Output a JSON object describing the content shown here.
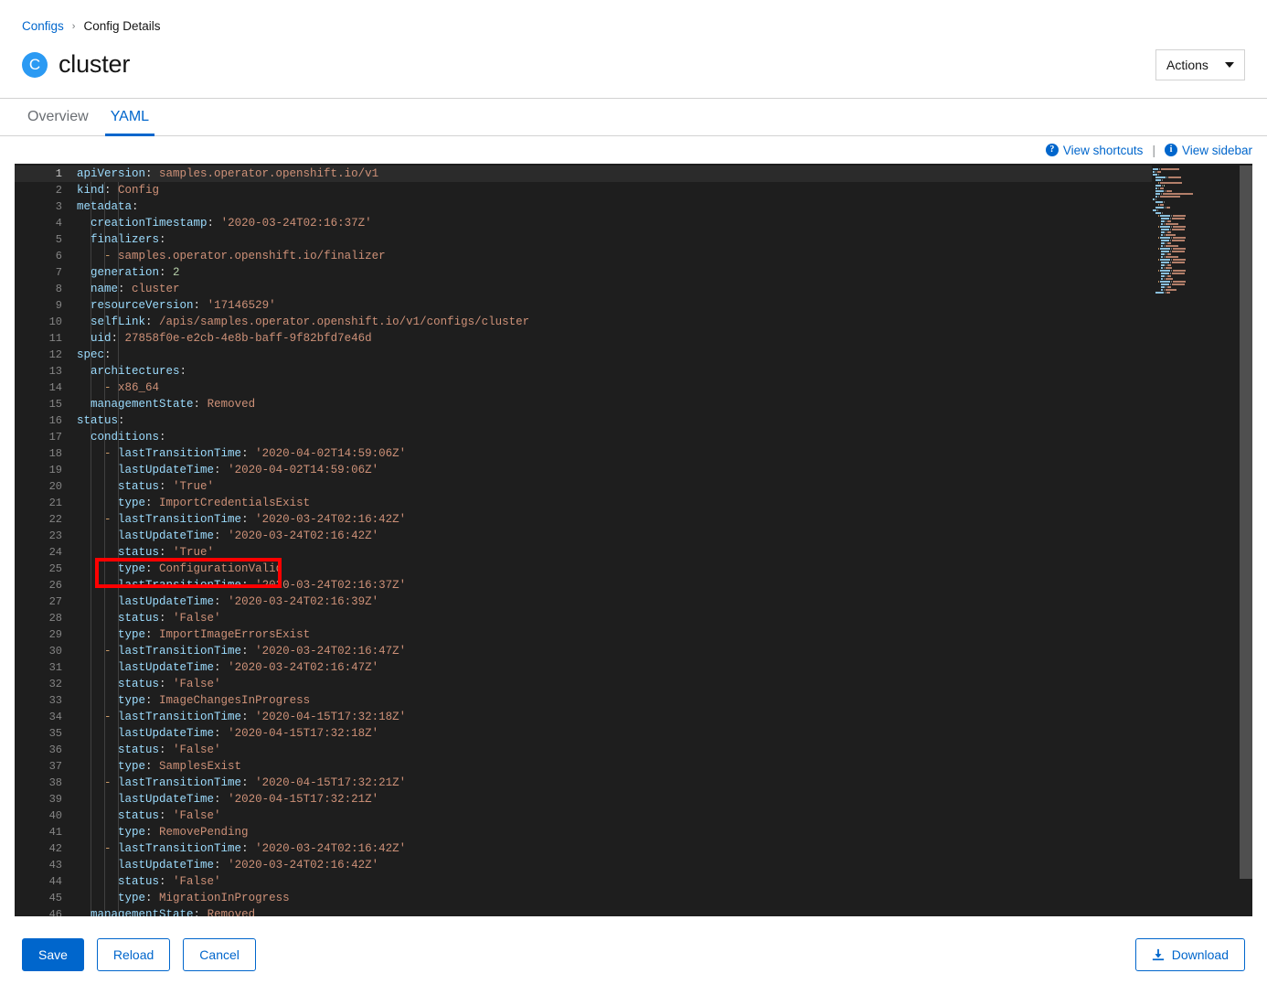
{
  "breadcrumb": {
    "parent": "Configs",
    "separator": "›",
    "current": "Config Details"
  },
  "header": {
    "badge_letter": "C",
    "resource_name": "cluster",
    "actions_label": "Actions",
    "badge_color": "#2b9af3"
  },
  "tabs": [
    {
      "label": "Overview",
      "active": false
    },
    {
      "label": "YAML",
      "active": true
    }
  ],
  "view_links": {
    "shortcuts_icon": "question-circle-icon",
    "shortcuts_label": "View shortcuts",
    "divider": "|",
    "sidebar_icon": "info-circle-icon",
    "sidebar_label": "View sidebar"
  },
  "annotation": {
    "type": "red-rectangle-highlight",
    "color": "#ff0000",
    "target_line": 15,
    "target_text": "managementState: Removed"
  },
  "editor": {
    "language": "yaml",
    "theme": "dark",
    "active_line": 1,
    "total_visible_lines": 46,
    "colors": {
      "background": "#1e1e1e",
      "active_line": "#2b2b2b",
      "line_number": "#858585",
      "line_number_active": "#c6c6c6",
      "key": "#9cdcfe",
      "value": "#ce9178",
      "number": "#b5cea8",
      "punctuation": "#d4d4d4"
    },
    "lines": [
      {
        "n": 1,
        "indent": 0,
        "tokens": [
          {
            "t": "key",
            "v": "apiVersion"
          },
          {
            "t": "punc",
            "v": ": "
          },
          {
            "t": "val",
            "v": "samples.operator.openshift.io/v1"
          }
        ]
      },
      {
        "n": 2,
        "indent": 0,
        "tokens": [
          {
            "t": "key",
            "v": "kind"
          },
          {
            "t": "punc",
            "v": ": "
          },
          {
            "t": "val",
            "v": "Config"
          }
        ]
      },
      {
        "n": 3,
        "indent": 0,
        "tokens": [
          {
            "t": "key",
            "v": "metadata"
          },
          {
            "t": "punc",
            "v": ":"
          }
        ]
      },
      {
        "n": 4,
        "indent": 1,
        "tokens": [
          {
            "t": "key",
            "v": "creationTimestamp"
          },
          {
            "t": "punc",
            "v": ": "
          },
          {
            "t": "val",
            "v": "'2020-03-24T02:16:37Z'"
          }
        ]
      },
      {
        "n": 5,
        "indent": 1,
        "tokens": [
          {
            "t": "key",
            "v": "finalizers"
          },
          {
            "t": "punc",
            "v": ":"
          }
        ]
      },
      {
        "n": 6,
        "indent": 2,
        "tokens": [
          {
            "t": "dash",
            "v": "- "
          },
          {
            "t": "val",
            "v": "samples.operator.openshift.io/finalizer"
          }
        ]
      },
      {
        "n": 7,
        "indent": 1,
        "tokens": [
          {
            "t": "key",
            "v": "generation"
          },
          {
            "t": "punc",
            "v": ": "
          },
          {
            "t": "num",
            "v": "2"
          }
        ]
      },
      {
        "n": 8,
        "indent": 1,
        "tokens": [
          {
            "t": "key",
            "v": "name"
          },
          {
            "t": "punc",
            "v": ": "
          },
          {
            "t": "val",
            "v": "cluster"
          }
        ]
      },
      {
        "n": 9,
        "indent": 1,
        "tokens": [
          {
            "t": "key",
            "v": "resourceVersion"
          },
          {
            "t": "punc",
            "v": ": "
          },
          {
            "t": "val",
            "v": "'17146529'"
          }
        ]
      },
      {
        "n": 10,
        "indent": 1,
        "tokens": [
          {
            "t": "key",
            "v": "selfLink"
          },
          {
            "t": "punc",
            "v": ": "
          },
          {
            "t": "val",
            "v": "/apis/samples.operator.openshift.io/v1/configs/cluster"
          }
        ]
      },
      {
        "n": 11,
        "indent": 1,
        "tokens": [
          {
            "t": "key",
            "v": "uid"
          },
          {
            "t": "punc",
            "v": ": "
          },
          {
            "t": "val",
            "v": "27858f0e-e2cb-4e8b-baff-9f82bfd7e46d"
          }
        ]
      },
      {
        "n": 12,
        "indent": 0,
        "tokens": [
          {
            "t": "key",
            "v": "spec"
          },
          {
            "t": "punc",
            "v": ":"
          }
        ]
      },
      {
        "n": 13,
        "indent": 1,
        "tokens": [
          {
            "t": "key",
            "v": "architectures"
          },
          {
            "t": "punc",
            "v": ":"
          }
        ]
      },
      {
        "n": 14,
        "indent": 2,
        "tokens": [
          {
            "t": "dash",
            "v": "- "
          },
          {
            "t": "val",
            "v": "x86_64"
          }
        ]
      },
      {
        "n": 15,
        "indent": 1,
        "tokens": [
          {
            "t": "key",
            "v": "managementState"
          },
          {
            "t": "punc",
            "v": ": "
          },
          {
            "t": "val",
            "v": "Removed"
          }
        ]
      },
      {
        "n": 16,
        "indent": 0,
        "tokens": [
          {
            "t": "key",
            "v": "status"
          },
          {
            "t": "punc",
            "v": ":"
          }
        ]
      },
      {
        "n": 17,
        "indent": 1,
        "tokens": [
          {
            "t": "key",
            "v": "conditions"
          },
          {
            "t": "punc",
            "v": ":"
          }
        ]
      },
      {
        "n": 18,
        "indent": 2,
        "tokens": [
          {
            "t": "dash",
            "v": "- "
          },
          {
            "t": "key",
            "v": "lastTransitionTime"
          },
          {
            "t": "punc",
            "v": ": "
          },
          {
            "t": "val",
            "v": "'2020-04-02T14:59:06Z'"
          }
        ]
      },
      {
        "n": 19,
        "indent": 3,
        "tokens": [
          {
            "t": "key",
            "v": "lastUpdateTime"
          },
          {
            "t": "punc",
            "v": ": "
          },
          {
            "t": "val",
            "v": "'2020-04-02T14:59:06Z'"
          }
        ]
      },
      {
        "n": 20,
        "indent": 3,
        "tokens": [
          {
            "t": "key",
            "v": "status"
          },
          {
            "t": "punc",
            "v": ": "
          },
          {
            "t": "val",
            "v": "'True'"
          }
        ]
      },
      {
        "n": 21,
        "indent": 3,
        "tokens": [
          {
            "t": "key",
            "v": "type"
          },
          {
            "t": "punc",
            "v": ": "
          },
          {
            "t": "val",
            "v": "ImportCredentialsExist"
          }
        ]
      },
      {
        "n": 22,
        "indent": 2,
        "tokens": [
          {
            "t": "dash",
            "v": "- "
          },
          {
            "t": "key",
            "v": "lastTransitionTime"
          },
          {
            "t": "punc",
            "v": ": "
          },
          {
            "t": "val",
            "v": "'2020-03-24T02:16:42Z'"
          }
        ]
      },
      {
        "n": 23,
        "indent": 3,
        "tokens": [
          {
            "t": "key",
            "v": "lastUpdateTime"
          },
          {
            "t": "punc",
            "v": ": "
          },
          {
            "t": "val",
            "v": "'2020-03-24T02:16:42Z'"
          }
        ]
      },
      {
        "n": 24,
        "indent": 3,
        "tokens": [
          {
            "t": "key",
            "v": "status"
          },
          {
            "t": "punc",
            "v": ": "
          },
          {
            "t": "val",
            "v": "'True'"
          }
        ]
      },
      {
        "n": 25,
        "indent": 3,
        "tokens": [
          {
            "t": "key",
            "v": "type"
          },
          {
            "t": "punc",
            "v": ": "
          },
          {
            "t": "val",
            "v": "ConfigurationValid"
          }
        ]
      },
      {
        "n": 26,
        "indent": 2,
        "tokens": [
          {
            "t": "dash",
            "v": "- "
          },
          {
            "t": "key",
            "v": "lastTransitionTime"
          },
          {
            "t": "punc",
            "v": ": "
          },
          {
            "t": "val",
            "v": "'2020-03-24T02:16:37Z'"
          }
        ]
      },
      {
        "n": 27,
        "indent": 3,
        "tokens": [
          {
            "t": "key",
            "v": "lastUpdateTime"
          },
          {
            "t": "punc",
            "v": ": "
          },
          {
            "t": "val",
            "v": "'2020-03-24T02:16:39Z'"
          }
        ]
      },
      {
        "n": 28,
        "indent": 3,
        "tokens": [
          {
            "t": "key",
            "v": "status"
          },
          {
            "t": "punc",
            "v": ": "
          },
          {
            "t": "val",
            "v": "'False'"
          }
        ]
      },
      {
        "n": 29,
        "indent": 3,
        "tokens": [
          {
            "t": "key",
            "v": "type"
          },
          {
            "t": "punc",
            "v": ": "
          },
          {
            "t": "val",
            "v": "ImportImageErrorsExist"
          }
        ]
      },
      {
        "n": 30,
        "indent": 2,
        "tokens": [
          {
            "t": "dash",
            "v": "- "
          },
          {
            "t": "key",
            "v": "lastTransitionTime"
          },
          {
            "t": "punc",
            "v": ": "
          },
          {
            "t": "val",
            "v": "'2020-03-24T02:16:47Z'"
          }
        ]
      },
      {
        "n": 31,
        "indent": 3,
        "tokens": [
          {
            "t": "key",
            "v": "lastUpdateTime"
          },
          {
            "t": "punc",
            "v": ": "
          },
          {
            "t": "val",
            "v": "'2020-03-24T02:16:47Z'"
          }
        ]
      },
      {
        "n": 32,
        "indent": 3,
        "tokens": [
          {
            "t": "key",
            "v": "status"
          },
          {
            "t": "punc",
            "v": ": "
          },
          {
            "t": "val",
            "v": "'False'"
          }
        ]
      },
      {
        "n": 33,
        "indent": 3,
        "tokens": [
          {
            "t": "key",
            "v": "type"
          },
          {
            "t": "punc",
            "v": ": "
          },
          {
            "t": "val",
            "v": "ImageChangesInProgress"
          }
        ]
      },
      {
        "n": 34,
        "indent": 2,
        "tokens": [
          {
            "t": "dash",
            "v": "- "
          },
          {
            "t": "key",
            "v": "lastTransitionTime"
          },
          {
            "t": "punc",
            "v": ": "
          },
          {
            "t": "val",
            "v": "'2020-04-15T17:32:18Z'"
          }
        ]
      },
      {
        "n": 35,
        "indent": 3,
        "tokens": [
          {
            "t": "key",
            "v": "lastUpdateTime"
          },
          {
            "t": "punc",
            "v": ": "
          },
          {
            "t": "val",
            "v": "'2020-04-15T17:32:18Z'"
          }
        ]
      },
      {
        "n": 36,
        "indent": 3,
        "tokens": [
          {
            "t": "key",
            "v": "status"
          },
          {
            "t": "punc",
            "v": ": "
          },
          {
            "t": "val",
            "v": "'False'"
          }
        ]
      },
      {
        "n": 37,
        "indent": 3,
        "tokens": [
          {
            "t": "key",
            "v": "type"
          },
          {
            "t": "punc",
            "v": ": "
          },
          {
            "t": "val",
            "v": "SamplesExist"
          }
        ]
      },
      {
        "n": 38,
        "indent": 2,
        "tokens": [
          {
            "t": "dash",
            "v": "- "
          },
          {
            "t": "key",
            "v": "lastTransitionTime"
          },
          {
            "t": "punc",
            "v": ": "
          },
          {
            "t": "val",
            "v": "'2020-04-15T17:32:21Z'"
          }
        ]
      },
      {
        "n": 39,
        "indent": 3,
        "tokens": [
          {
            "t": "key",
            "v": "lastUpdateTime"
          },
          {
            "t": "punc",
            "v": ": "
          },
          {
            "t": "val",
            "v": "'2020-04-15T17:32:21Z'"
          }
        ]
      },
      {
        "n": 40,
        "indent": 3,
        "tokens": [
          {
            "t": "key",
            "v": "status"
          },
          {
            "t": "punc",
            "v": ": "
          },
          {
            "t": "val",
            "v": "'False'"
          }
        ]
      },
      {
        "n": 41,
        "indent": 3,
        "tokens": [
          {
            "t": "key",
            "v": "type"
          },
          {
            "t": "punc",
            "v": ": "
          },
          {
            "t": "val",
            "v": "RemovePending"
          }
        ]
      },
      {
        "n": 42,
        "indent": 2,
        "tokens": [
          {
            "t": "dash",
            "v": "- "
          },
          {
            "t": "key",
            "v": "lastTransitionTime"
          },
          {
            "t": "punc",
            "v": ": "
          },
          {
            "t": "val",
            "v": "'2020-03-24T02:16:42Z'"
          }
        ]
      },
      {
        "n": 43,
        "indent": 3,
        "tokens": [
          {
            "t": "key",
            "v": "lastUpdateTime"
          },
          {
            "t": "punc",
            "v": ": "
          },
          {
            "t": "val",
            "v": "'2020-03-24T02:16:42Z'"
          }
        ]
      },
      {
        "n": 44,
        "indent": 3,
        "tokens": [
          {
            "t": "key",
            "v": "status"
          },
          {
            "t": "punc",
            "v": ": "
          },
          {
            "t": "val",
            "v": "'False'"
          }
        ]
      },
      {
        "n": 45,
        "indent": 3,
        "tokens": [
          {
            "t": "key",
            "v": "type"
          },
          {
            "t": "punc",
            "v": ": "
          },
          {
            "t": "val",
            "v": "MigrationInProgress"
          }
        ]
      },
      {
        "n": 46,
        "indent": 1,
        "tokens": [
          {
            "t": "key",
            "v": "managementState"
          },
          {
            "t": "punc",
            "v": ": "
          },
          {
            "t": "val",
            "v": "Removed"
          }
        ]
      }
    ]
  },
  "footer": {
    "save_label": "Save",
    "reload_label": "Reload",
    "cancel_label": "Cancel",
    "download_label": "Download",
    "download_icon": "download-icon"
  }
}
